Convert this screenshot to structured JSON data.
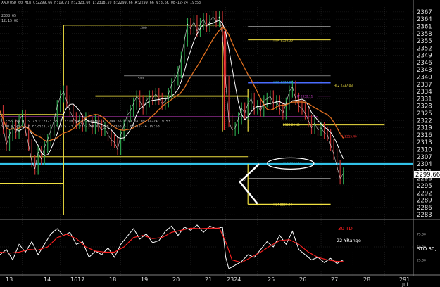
{
  "header": {
    "topline": "XAU/USD 60 Min  C:2299.66  H:19.73  H:2323.60  L:2318.59  B:2299.66  A:2299.66  V:8.6K  08-12-24 19:53",
    "line2": "2308.65",
    "line3": "12:15:08",
    "left_label": "XAU/USD 60 Min",
    "ohlc": "C:2299.66 H:19.73 L:2323.55 C:2310.59 B:2299.66 A:2299.66 V:$1.6K 09-12-24 19:53",
    "vol_line": "5.00 C:2321.16 H:2323.73 L:2315.73 C:2322.65 V5,008 L2368.57 08-12-24 19:53"
  },
  "colors": {
    "background": "#000000",
    "price": "#ffffff",
    "candle": "#2aa04a",
    "ma_fast": "#ffffff",
    "ma_slow": "#e07020",
    "support_cyan": "#31c2e8",
    "support_blue": "#4a6cff",
    "pivot_yellow": "#f0e040",
    "magenta": "#d040d0",
    "red_level": "#ff3030",
    "grid": "#3a3a3a",
    "sto_line": "#ffffff",
    "sto_signal": "#ff2020"
  },
  "chart_data": {
    "type": "line",
    "title": "",
    "xlabel": "",
    "ylabel": "",
    "x_ticks": [
      "13",
      "14",
      "1617",
      "18",
      "19",
      "20",
      "21",
      "2324",
      "25",
      "26",
      "27",
      "28",
      "291"
    ],
    "x_extra": "Jul",
    "y_ticks": [
      2367,
      2364,
      2361,
      2358,
      2355,
      2352,
      2349,
      2346,
      2343,
      2340,
      2337,
      2334,
      2331,
      2328,
      2325,
      2322,
      2319,
      2316,
      2313,
      2310,
      2307,
      2304,
      2301,
      2298,
      2295,
      2292,
      2289,
      2286,
      2283
    ],
    "ylim": [
      2281,
      2369
    ],
    "last_price": "2299.66",
    "x_range": [
      0,
      130
    ],
    "series": [
      {
        "values": [
          [
            0,
            2326
          ],
          [
            1,
            2319
          ],
          [
            2,
            2312
          ],
          [
            3,
            2316
          ],
          [
            4,
            2320
          ],
          [
            5,
            2317
          ],
          [
            6,
            2322
          ],
          [
            7,
            2324
          ],
          [
            8,
            2318
          ],
          [
            9,
            2312
          ],
          [
            10,
            2305
          ],
          [
            11,
            2302
          ],
          [
            12,
            2309
          ],
          [
            13,
            2306
          ],
          [
            14,
            2311
          ],
          [
            15,
            2314
          ],
          [
            16,
            2318
          ],
          [
            17,
            2322
          ],
          [
            18,
            2328
          ],
          [
            19,
            2332
          ],
          [
            20,
            2334
          ],
          [
            21,
            2330
          ],
          [
            22,
            2326
          ],
          [
            23,
            2323
          ],
          [
            24,
            2321
          ],
          [
            25,
            2322
          ],
          [
            26,
            2320
          ],
          [
            27,
            2323
          ],
          [
            28,
            2321
          ],
          [
            29,
            2319
          ],
          [
            30,
            2322
          ],
          [
            31,
            2320
          ],
          [
            32,
            2318
          ],
          [
            33,
            2319
          ],
          [
            34,
            2316
          ],
          [
            35,
            2314
          ],
          [
            36,
            2313
          ],
          [
            37,
            2310
          ],
          [
            38,
            2316
          ],
          [
            39,
            2320
          ],
          [
            40,
            2324
          ],
          [
            41,
            2326
          ],
          [
            42,
            2329
          ],
          [
            43,
            2332
          ],
          [
            44,
            2330
          ],
          [
            45,
            2327
          ],
          [
            46,
            2330
          ],
          [
            47,
            2332
          ],
          [
            48,
            2331
          ],
          [
            49,
            2333
          ],
          [
            50,
            2331
          ],
          [
            51,
            2329
          ],
          [
            52,
            2330
          ],
          [
            53,
            2333
          ],
          [
            54,
            2337
          ],
          [
            55,
            2339
          ],
          [
            56,
            2342
          ],
          [
            57,
            2348
          ],
          [
            58,
            2355
          ],
          [
            59,
            2362
          ],
          [
            60,
            2360
          ],
          [
            61,
            2363
          ],
          [
            62,
            2359
          ],
          [
            63,
            2362
          ],
          [
            64,
            2364
          ],
          [
            65,
            2361
          ],
          [
            66,
            2363
          ],
          [
            67,
            2365
          ],
          [
            68,
            2363
          ],
          [
            69,
            2365
          ],
          [
            70,
            2357
          ],
          [
            71,
            2338
          ],
          [
            72,
            2322
          ],
          [
            73,
            2318
          ],
          [
            74,
            2319
          ],
          [
            75,
            2323
          ],
          [
            76,
            2327
          ],
          [
            77,
            2325
          ],
          [
            78,
            2329
          ],
          [
            79,
            2331
          ],
          [
            80,
            2327
          ],
          [
            81,
            2328
          ],
          [
            82,
            2326
          ],
          [
            83,
            2330
          ],
          [
            84,
            2331
          ],
          [
            85,
            2332
          ],
          [
            86,
            2329
          ],
          [
            87,
            2330
          ],
          [
            88,
            2327
          ],
          [
            89,
            2325
          ],
          [
            90,
            2329
          ],
          [
            91,
            2334
          ],
          [
            92,
            2336
          ],
          [
            93,
            2331
          ],
          [
            94,
            2328
          ],
          [
            95,
            2327
          ],
          [
            96,
            2325
          ],
          [
            97,
            2322
          ],
          [
            98,
            2319
          ],
          [
            99,
            2321
          ],
          [
            100,
            2318
          ],
          [
            101,
            2319
          ],
          [
            102,
            2317
          ],
          [
            103,
            2316
          ],
          [
            104,
            2312
          ],
          [
            105,
            2308
          ],
          [
            106,
            2303
          ],
          [
            107,
            2298
          ],
          [
            108,
            2300
          ]
        ]
      }
    ],
    "sto_panel": {
      "title": "30 TD",
      "subtitle": "22 YRange",
      "label": "STO  30,",
      "ticks": [
        "75.00",
        "50.00",
        "25.00"
      ],
      "ylim": [
        0,
        100
      ],
      "sto_values": [
        [
          0,
          35
        ],
        [
          2,
          45
        ],
        [
          4,
          25
        ],
        [
          6,
          55
        ],
        [
          8,
          40
        ],
        [
          10,
          60
        ],
        [
          12,
          35
        ],
        [
          14,
          55
        ],
        [
          16,
          75
        ],
        [
          18,
          85
        ],
        [
          20,
          72
        ],
        [
          22,
          78
        ],
        [
          24,
          55
        ],
        [
          26,
          60
        ],
        [
          28,
          30
        ],
        [
          30,
          42
        ],
        [
          32,
          35
        ],
        [
          34,
          48
        ],
        [
          36,
          30
        ],
        [
          38,
          55
        ],
        [
          40,
          70
        ],
        [
          42,
          85
        ],
        [
          44,
          65
        ],
        [
          46,
          75
        ],
        [
          48,
          58
        ],
        [
          50,
          62
        ],
        [
          52,
          80
        ],
        [
          54,
          90
        ],
        [
          56,
          72
        ],
        [
          58,
          88
        ],
        [
          60,
          82
        ],
        [
          62,
          92
        ],
        [
          64,
          78
        ],
        [
          66,
          90
        ],
        [
          68,
          85
        ],
        [
          70,
          88
        ],
        [
          71,
          30
        ],
        [
          72,
          8
        ],
        [
          74,
          15
        ],
        [
          76,
          22
        ],
        [
          78,
          35
        ],
        [
          80,
          30
        ],
        [
          82,
          45
        ],
        [
          84,
          60
        ],
        [
          86,
          50
        ],
        [
          88,
          72
        ],
        [
          90,
          55
        ],
        [
          92,
          80
        ],
        [
          94,
          45
        ],
        [
          96,
          35
        ],
        [
          98,
          25
        ],
        [
          100,
          30
        ],
        [
          102,
          20
        ],
        [
          104,
          28
        ],
        [
          106,
          18
        ],
        [
          108,
          25
        ]
      ],
      "signal_values": [
        [
          0,
          40
        ],
        [
          3,
          38
        ],
        [
          6,
          40
        ],
        [
          9,
          45
        ],
        [
          12,
          44
        ],
        [
          15,
          50
        ],
        [
          18,
          68
        ],
        [
          21,
          74
        ],
        [
          24,
          66
        ],
        [
          27,
          50
        ],
        [
          30,
          42
        ],
        [
          33,
          40
        ],
        [
          36,
          40
        ],
        [
          39,
          50
        ],
        [
          42,
          68
        ],
        [
          45,
          72
        ],
        [
          48,
          66
        ],
        [
          51,
          68
        ],
        [
          54,
          78
        ],
        [
          57,
          82
        ],
        [
          60,
          86
        ],
        [
          63,
          85
        ],
        [
          66,
          86
        ],
        [
          69,
          86
        ],
        [
          71,
          60
        ],
        [
          73,
          25
        ],
        [
          76,
          20
        ],
        [
          79,
          30
        ],
        [
          82,
          40
        ],
        [
          85,
          52
        ],
        [
          88,
          62
        ],
        [
          91,
          64
        ],
        [
          94,
          55
        ],
        [
          97,
          40
        ],
        [
          100,
          30
        ],
        [
          103,
          25
        ],
        [
          106,
          22
        ],
        [
          108,
          22
        ]
      ]
    }
  },
  "annotations": {
    "level_labels": [
      {
        "text": "HH4 2355.38",
        "color": "#f0e040"
      },
      {
        "text": "HH3 2338.29",
        "color": "#31c2e8"
      },
      {
        "text": "HL2 2337.03",
        "color": "#f0e040"
      },
      {
        "text": "HT 2332.11",
        "color": "#d040d0"
      },
      {
        "text": "2320.29 40",
        "color": "#f0e040"
      },
      {
        "text": "TL 2315.46",
        "color": "#ff3030"
      },
      {
        "text": "HL3 2304.13",
        "color": "#31c2e8"
      },
      {
        "text": "HL4 2287.34",
        "color": "#f0e040"
      }
    ],
    "box_labels": [
      ".500",
      ".500",
      ".500"
    ],
    "levels": {
      "cyan": 2304.0,
      "blue_upper": 2337.6,
      "yellow_hh4": 2355.4,
      "yellow_mid": 2320.3,
      "yellow_low": 2287.3,
      "magenta": 2323.5,
      "magenta2": 2332.1,
      "red": 2315.5,
      "white_upper": 2361.0,
      "white_mid": 2340.5,
      "white_low": 2298.0
    },
    "boxes": [
      {
        "x0": 20,
        "x1": 70,
        "y_top": 2362,
        "y_bottom": 2302
      },
      {
        "x0": 0,
        "x1": 20,
        "y_top": 2296,
        "y_bottom": 2296
      },
      {
        "x0": 70,
        "x1": 90,
        "y_top": 2335,
        "y_bottom": 2304
      }
    ]
  }
}
